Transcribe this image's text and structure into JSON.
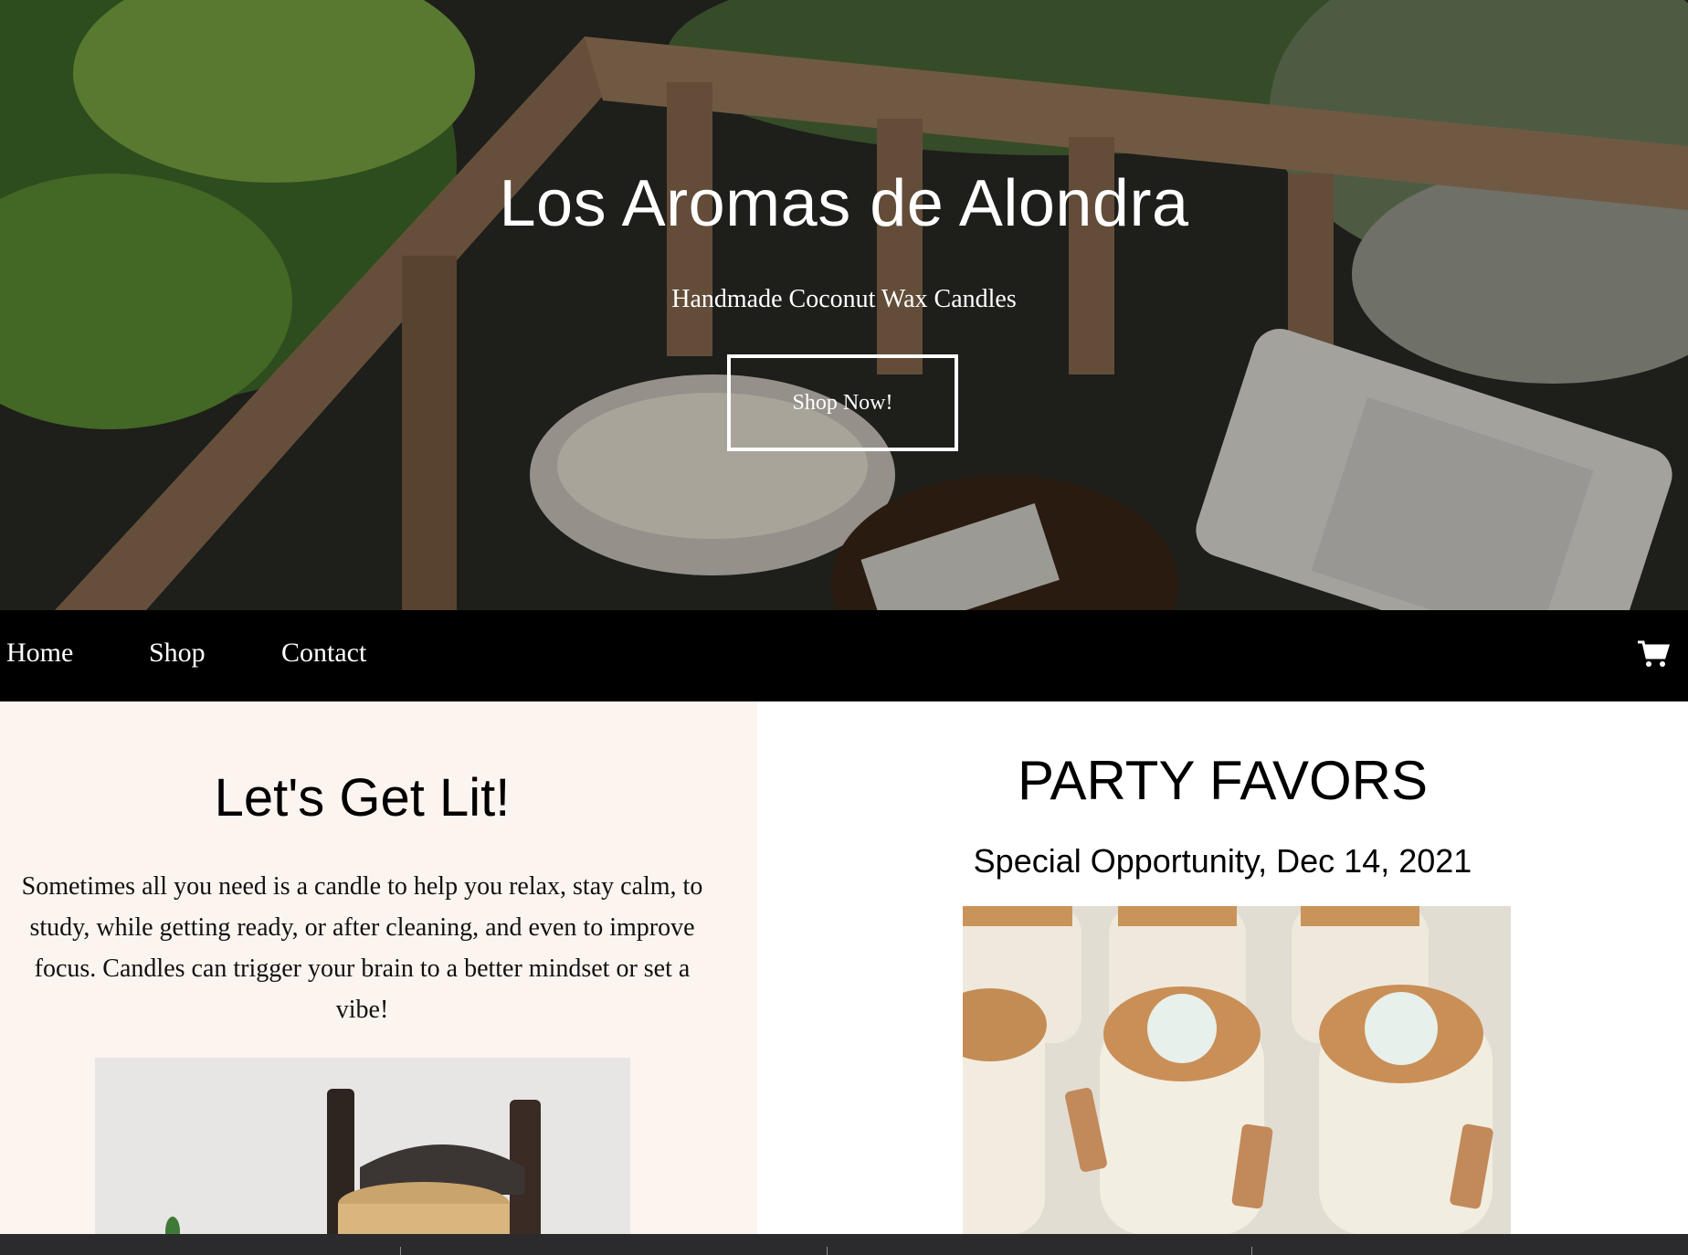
{
  "hero": {
    "title": "Los Aromas de Alondra",
    "subtitle": "Handmade Coconut Wax Candles",
    "button_label": "Shop Now!"
  },
  "nav": {
    "links": [
      {
        "label": "Home"
      },
      {
        "label": "Shop"
      },
      {
        "label": "Contact"
      }
    ],
    "cart_icon": "shopping-cart-icon"
  },
  "left": {
    "heading": "Let's Get Lit!",
    "body": "Sometimes all you need is a candle to help you relax, stay calm, to study, while getting ready, or after cleaning, and even to improve focus. Candles can trigger your brain to a better mindset or set a vibe!"
  },
  "right": {
    "heading": "PARTY FAVORS",
    "subheading": "Special Opportunity, Dec 14, 2021"
  },
  "colors": {
    "nav_bg": "#000000",
    "left_panel_bg": "#fcf4ef",
    "bottom_bar_bg": "#2b2b2d",
    "hero_text": "#ffffff"
  }
}
